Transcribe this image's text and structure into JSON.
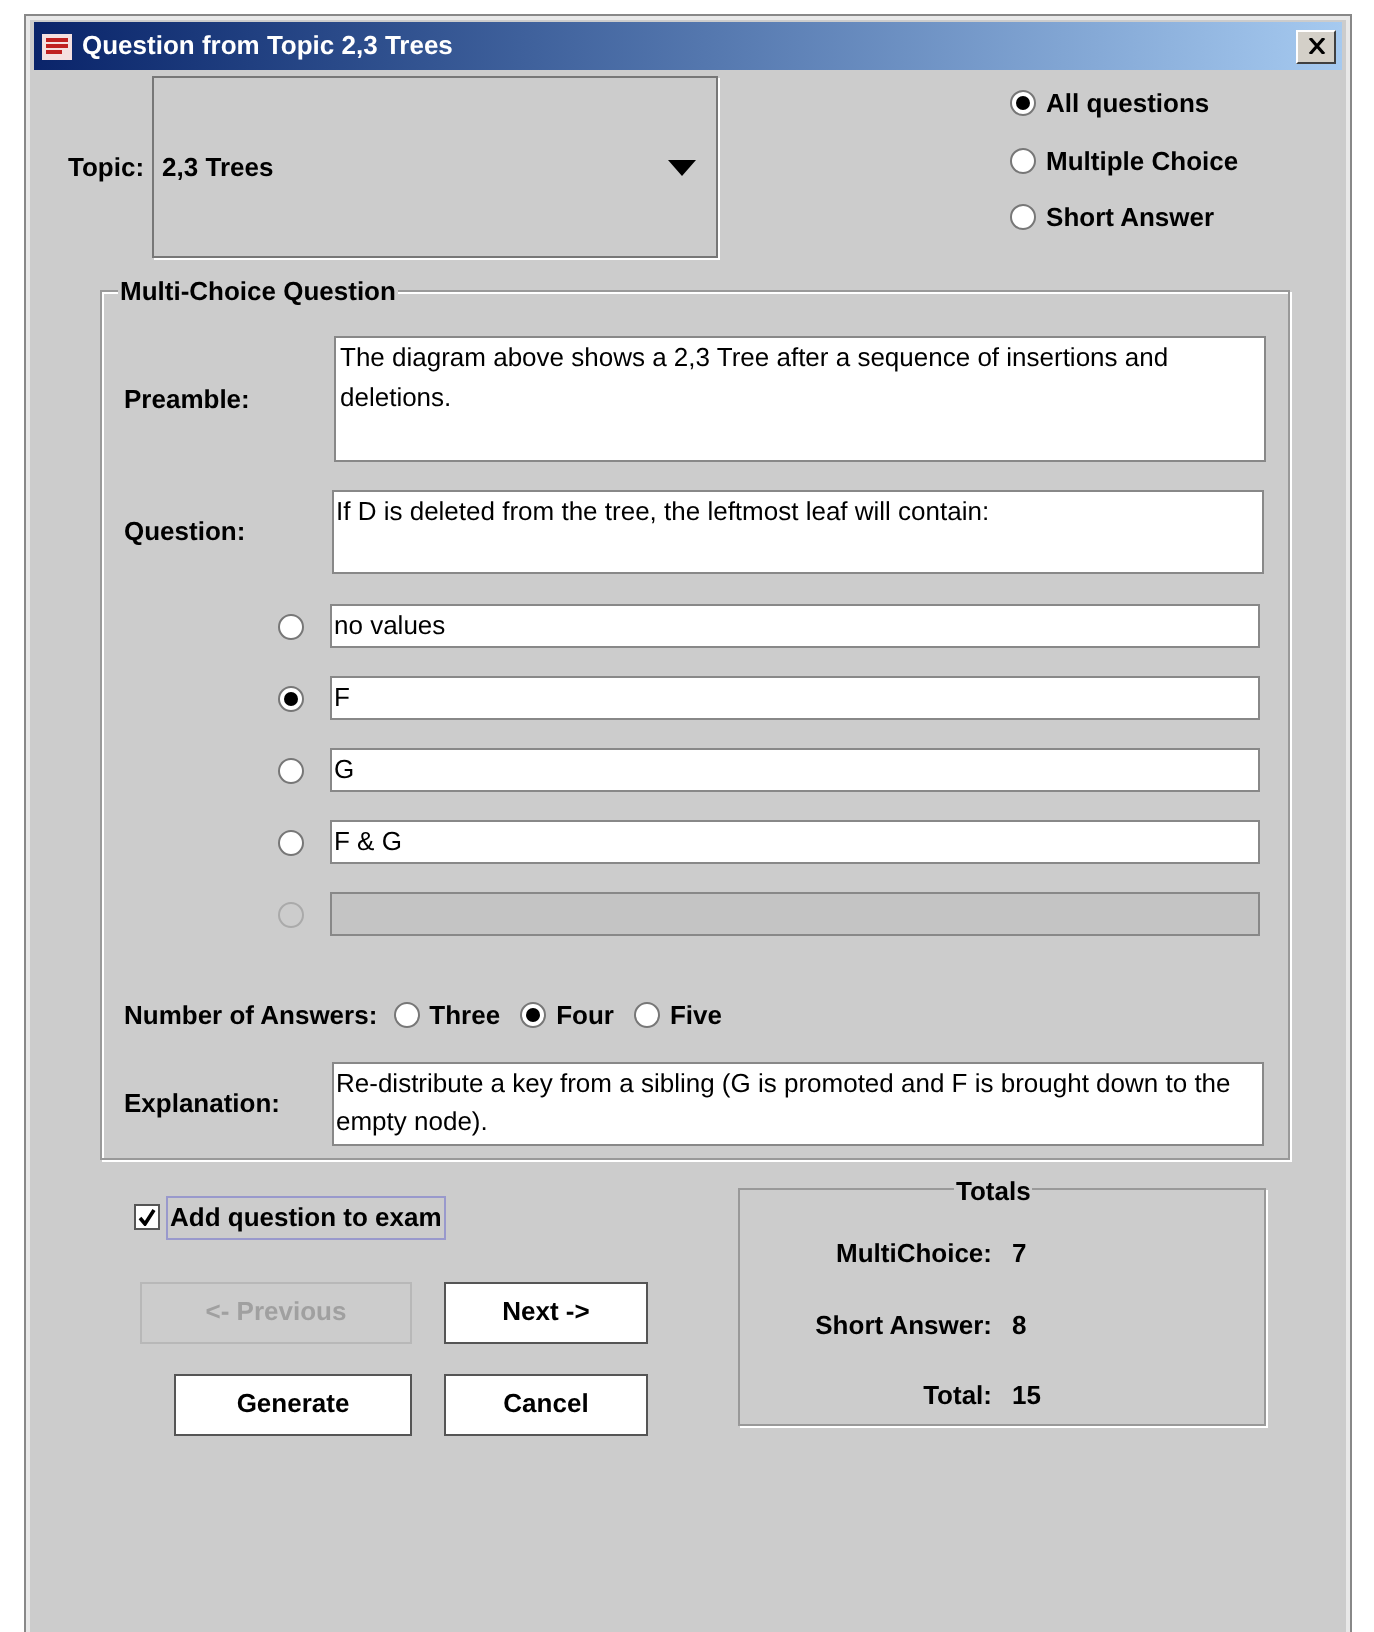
{
  "window": {
    "title": "Question from Topic 2,3 Trees"
  },
  "topic": {
    "label": "Topic:",
    "value": "2,3 Trees"
  },
  "filter": [
    {
      "label": "All questions",
      "selected": true
    },
    {
      "label": "Multiple Choice",
      "selected": false
    },
    {
      "label": "Short Answer",
      "selected": false
    }
  ],
  "question_group": {
    "title": "Multi-Choice Question",
    "preamble": {
      "label": "Preamble:",
      "value": "The diagram above shows a 2,3 Tree after a sequence of insertions and deletions."
    },
    "question": {
      "label": "Question:",
      "value": "If D is deleted from the tree, the leftmost leaf will contain:"
    },
    "answers": [
      {
        "value": "no values",
        "selected": false,
        "disabled": false
      },
      {
        "value": "F",
        "selected": true,
        "disabled": false
      },
      {
        "value": "G",
        "selected": false,
        "disabled": false
      },
      {
        "value": "F & G",
        "selected": false,
        "disabled": false
      },
      {
        "selected": false,
        "disabled": true
      }
    ],
    "number_of_answers": {
      "label": "Number of Answers:",
      "options": [
        {
          "label": "Three",
          "selected": false
        },
        {
          "label": "Four",
          "selected": true
        },
        {
          "label": "Five",
          "selected": false
        }
      ]
    },
    "explanation": {
      "label": "Explanation:",
      "value": "Re-distribute a key from a sibling (G is promoted and F is brought down to the empty node)."
    }
  },
  "add_to_exam": {
    "label": "Add question to exam",
    "checked": true
  },
  "buttons": [
    {
      "label": "<- Previous",
      "disabled": true
    },
    {
      "label": "Next ->",
      "disabled": false
    },
    {
      "label": "Generate",
      "disabled": false
    },
    {
      "label": "Cancel",
      "disabled": false
    }
  ],
  "totals": {
    "title": "Totals",
    "rows": [
      {
        "label": "MultiChoice:",
        "value": "7"
      },
      {
        "label": "Short Answer:",
        "value": "8"
      },
      {
        "label": "Total:",
        "value": "15"
      }
    ]
  }
}
